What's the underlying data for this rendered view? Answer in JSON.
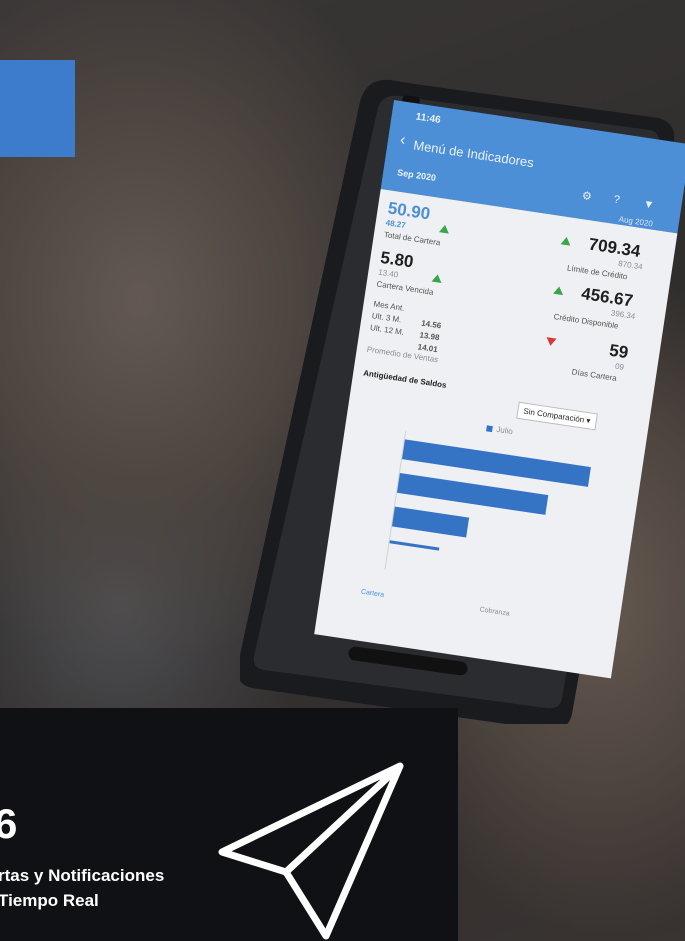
{
  "banner": {
    "number": "6",
    "title_line1": "rtas y Notificaciones",
    "title_line2": "Tiempo Real"
  },
  "app": {
    "status_time": "11:46",
    "header_title": "Menú de Indicadores",
    "period_current": "Sep 2020",
    "period_compare": "Aug 2020",
    "indicators": {
      "total_cartera": {
        "value": "50.90",
        "compare": "48.27",
        "label": "Total de Cartera",
        "trend": "up"
      },
      "cartera_vencida": {
        "value": "5.80",
        "compare": "13.40",
        "label": "Cartera Vencida",
        "trend": "up"
      },
      "limite_credito": {
        "value": "709.34",
        "compare": "870.34",
        "label": "Límite de Crédito",
        "trend": "up"
      },
      "credito_disponible": {
        "value": "456.67",
        "compare": "396.34",
        "label": "Crédito Disponible",
        "trend": "up"
      },
      "dias_cartera": {
        "value": "59",
        "compare": "09",
        "label": "Días Cartera",
        "trend": "down"
      }
    },
    "promedio": {
      "rows": [
        {
          "label": "Mes Ant.",
          "value": ""
        },
        {
          "label": "Ult. 3 M.",
          "value": "14.56"
        },
        {
          "label": "Ult. 12 M.",
          "value": "13.98"
        },
        {
          "label": "",
          "value": "14.01"
        }
      ],
      "label": "Promedio de Ventas"
    },
    "section_title": "Antigüedad de Saldos",
    "compare_select": "Sin Comparación",
    "legend": "Julio",
    "tabs": [
      "Cartera",
      "Cobranza"
    ]
  },
  "chart_data": {
    "type": "bar",
    "categories": [
      "",
      "",
      "",
      ""
    ],
    "series": [
      {
        "name": "Julio",
        "values": [
          150,
          120,
          60,
          40
        ]
      }
    ]
  },
  "colors": {
    "accent": "#3d7ccc",
    "header": "#4c8fd6",
    "up": "#3aa648",
    "down": "#d83a3a",
    "panel": "#101114"
  },
  "icons": [
    "back-icon",
    "settings-icon",
    "help-icon",
    "filter-icon",
    "paper-plane-icon"
  ]
}
